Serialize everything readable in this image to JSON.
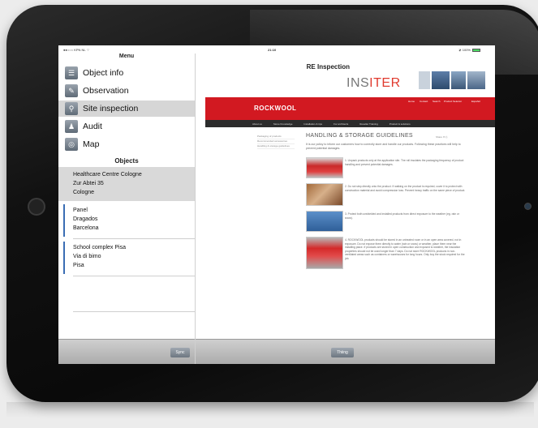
{
  "status_bar": {
    "carrier": "●●○○○ KPN NL ⌔",
    "time": "21:10",
    "battery": "≵ 100%"
  },
  "menu": {
    "title": "Menu",
    "items": [
      {
        "label": "Object info",
        "icon": "document-icon"
      },
      {
        "label": "Observation",
        "icon": "pencil-icon"
      },
      {
        "label": "Site inspection",
        "icon": "magnifier-icon",
        "active": true
      },
      {
        "label": "Audit",
        "icon": "audit-icon"
      },
      {
        "label": "Map",
        "icon": "map-icon"
      }
    ]
  },
  "objects": {
    "title": "Objects",
    "list": [
      {
        "lines": [
          "Healthcare Centre Cologne",
          "Zur Abtei 35",
          "Cologne"
        ],
        "selected": true
      },
      {
        "lines": [
          "Panel",
          "Dragados",
          "Barcelona"
        ],
        "selected": false
      },
      {
        "lines": [
          "School complex Pisa",
          "Via di bimo",
          "Pisa"
        ],
        "selected": false
      }
    ]
  },
  "inspection": {
    "title": "RE Inspection",
    "brand": "INSITER"
  },
  "rockwool": {
    "logo": "ROCKWOOL",
    "top_links": [
      "Home",
      "Contact",
      "Search",
      "Product Selector",
      "Español"
    ],
    "nav": [
      "About us",
      "Stone Knowledge",
      "Installation & tips",
      "For architects",
      "Reseller Training",
      "Product & solutions"
    ],
    "side_links": [
      "Packaging of products",
      "Recommended accessories",
      "Handling & storage guidelines"
    ],
    "heading": "HANDLING & STORAGE GUIDELINES",
    "share": "Share ✉ ⎙",
    "intro": "It is our policy to inform our customers how to correctly store and handle our products. Following these practices will help to prevent potential damages.",
    "steps": [
      "1. Unpack products only at the application site. The roll insulates the packaging frequency of product handling and prevent potential damages.",
      "2. Do not step directly onto the product. If walking on the product is required, cover it to protect with construction material and avoid compression loss. Prevent heavy traffic on the same piece of product.",
      "3. Protect both unshielded and installed products from direct exposure to the weather (eg. rain or snow).",
      "4. ROCKWOOL products should be stored in an unheated room or in an open area covered, not in exposure. Do not expose them directly to water (rain or snow) or weather, place them near the installing place. If products are stored in open construction and exposed to weather, the insulation properties should not be used longer than 7 days. Do not store ROCKWOOL products in non-ventilated areas such as containers or warehouses for long hours. Only buy the stock required for the job."
    ]
  },
  "bottom": {
    "left_button": "Sync",
    "right_button": "Thiing"
  },
  "colors": {
    "rockwool_red": "#d21921",
    "nav_dark": "#2c2c2c",
    "selection": "#d6d6d6"
  }
}
